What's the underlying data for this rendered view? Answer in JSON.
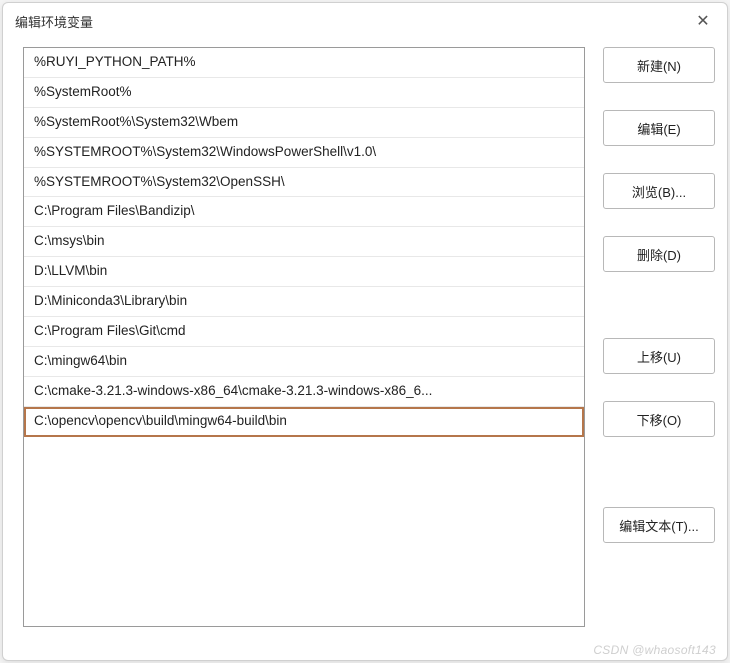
{
  "dialog": {
    "title": "编辑环境变量"
  },
  "paths": [
    "%RUYI_PYTHON_PATH%",
    "%SystemRoot%",
    "%SystemRoot%\\System32\\Wbem",
    "%SYSTEMROOT%\\System32\\WindowsPowerShell\\v1.0\\",
    "%SYSTEMROOT%\\System32\\OpenSSH\\",
    "C:\\Program Files\\Bandizip\\",
    "C:\\msys\\bin",
    "D:\\LLVM\\bin",
    "D:\\Miniconda3\\Library\\bin",
    "C:\\Program Files\\Git\\cmd",
    "C:\\mingw64\\bin",
    "C:\\cmake-3.21.3-windows-x86_64\\cmake-3.21.3-windows-x86_6...",
    "C:\\opencv\\opencv\\build\\mingw64-build\\bin"
  ],
  "highlighted_index": 12,
  "buttons": {
    "new": "新建(N)",
    "edit": "编辑(E)",
    "browse": "浏览(B)...",
    "delete": "删除(D)",
    "moveup": "上移(U)",
    "movedown": "下移(O)",
    "edittext": "编辑文本(T)..."
  },
  "watermark": "CSDN @whaosoft143"
}
